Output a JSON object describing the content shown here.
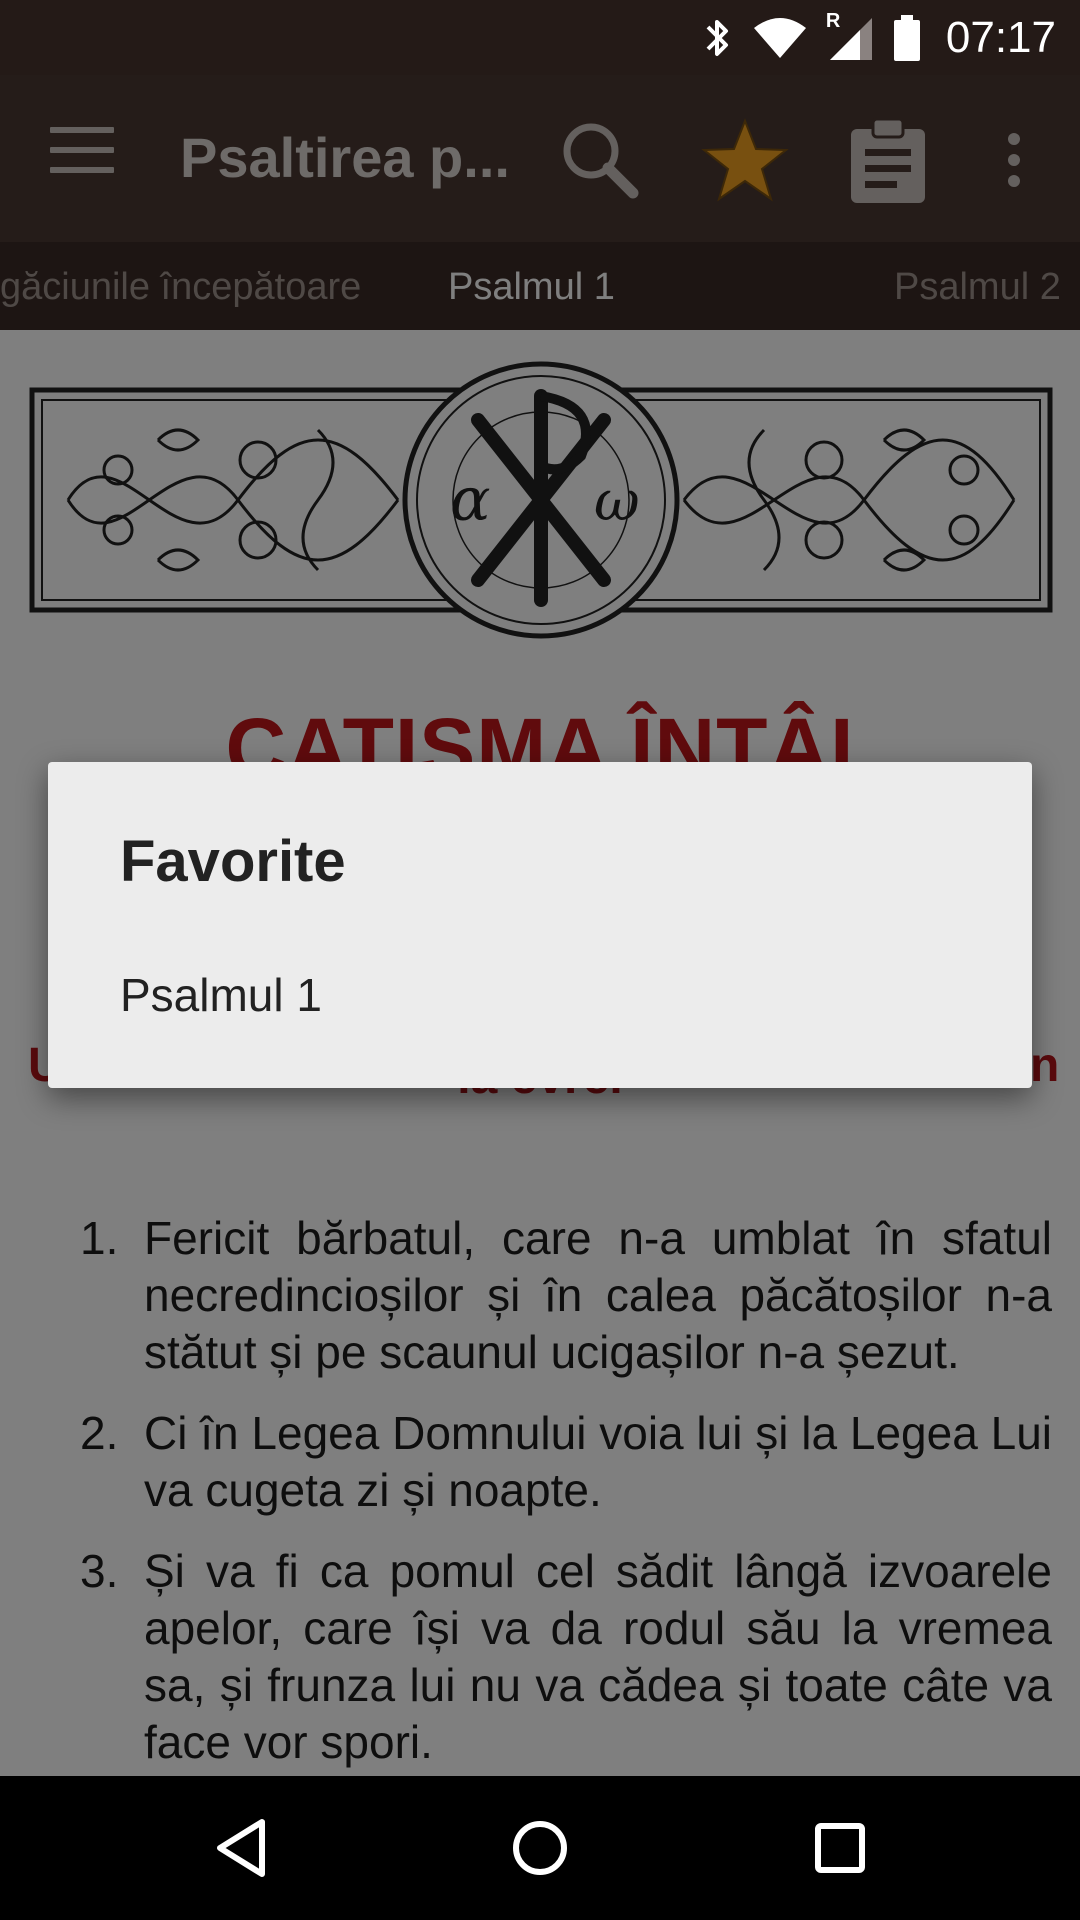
{
  "status_bar": {
    "time": "07:17",
    "icons": [
      "bluetooth-icon",
      "wifi-icon",
      "signal-roaming-icon",
      "battery-icon"
    ],
    "roaming_label": "R"
  },
  "app_bar": {
    "title": "Psaltirea p...",
    "icons": [
      "menu-icon",
      "search-icon",
      "star-icon",
      "clipboard-icon",
      "more-vert-icon"
    ]
  },
  "tabs": [
    {
      "label": "găciunile începătoare",
      "active": false
    },
    {
      "label": "Psalmul 1",
      "active": true
    },
    {
      "label": "Psalmul 2",
      "active": false
    }
  ],
  "content": {
    "ornament_monogram": [
      "α",
      "P",
      "ω"
    ],
    "heading": "CATISMA ÎNTÂI",
    "subheading": "la evrei",
    "verses": [
      {
        "num": "1.",
        "text": "Fericit bărbatul, care n-a umblat în sfatul necredincioșilor și în calea păcătoșilor n-a stătut și pe scaunul ucigașilor n-a șezut."
      },
      {
        "num": "2.",
        "text": "Ci în Legea Domnului voia lui și la Legea Lui va cugeta zi și noapte."
      },
      {
        "num": "3.",
        "text": "Și va fi ca pomul cel sădit lângă izvoarele apelor, care își va da rodul său la vremea sa, și frunza lui nu va cădea și toate câte va face vor spori."
      }
    ]
  },
  "dialog": {
    "title": "Favorite",
    "items": [
      "Psalmul 1"
    ]
  },
  "nav_bar": {
    "icons": [
      "back-icon",
      "home-icon",
      "recents-icon"
    ]
  },
  "colors": {
    "app_bar": "#4b3832",
    "status_bar": "#241a17",
    "heading_red": "#c1161b",
    "star": "#f0a020"
  }
}
